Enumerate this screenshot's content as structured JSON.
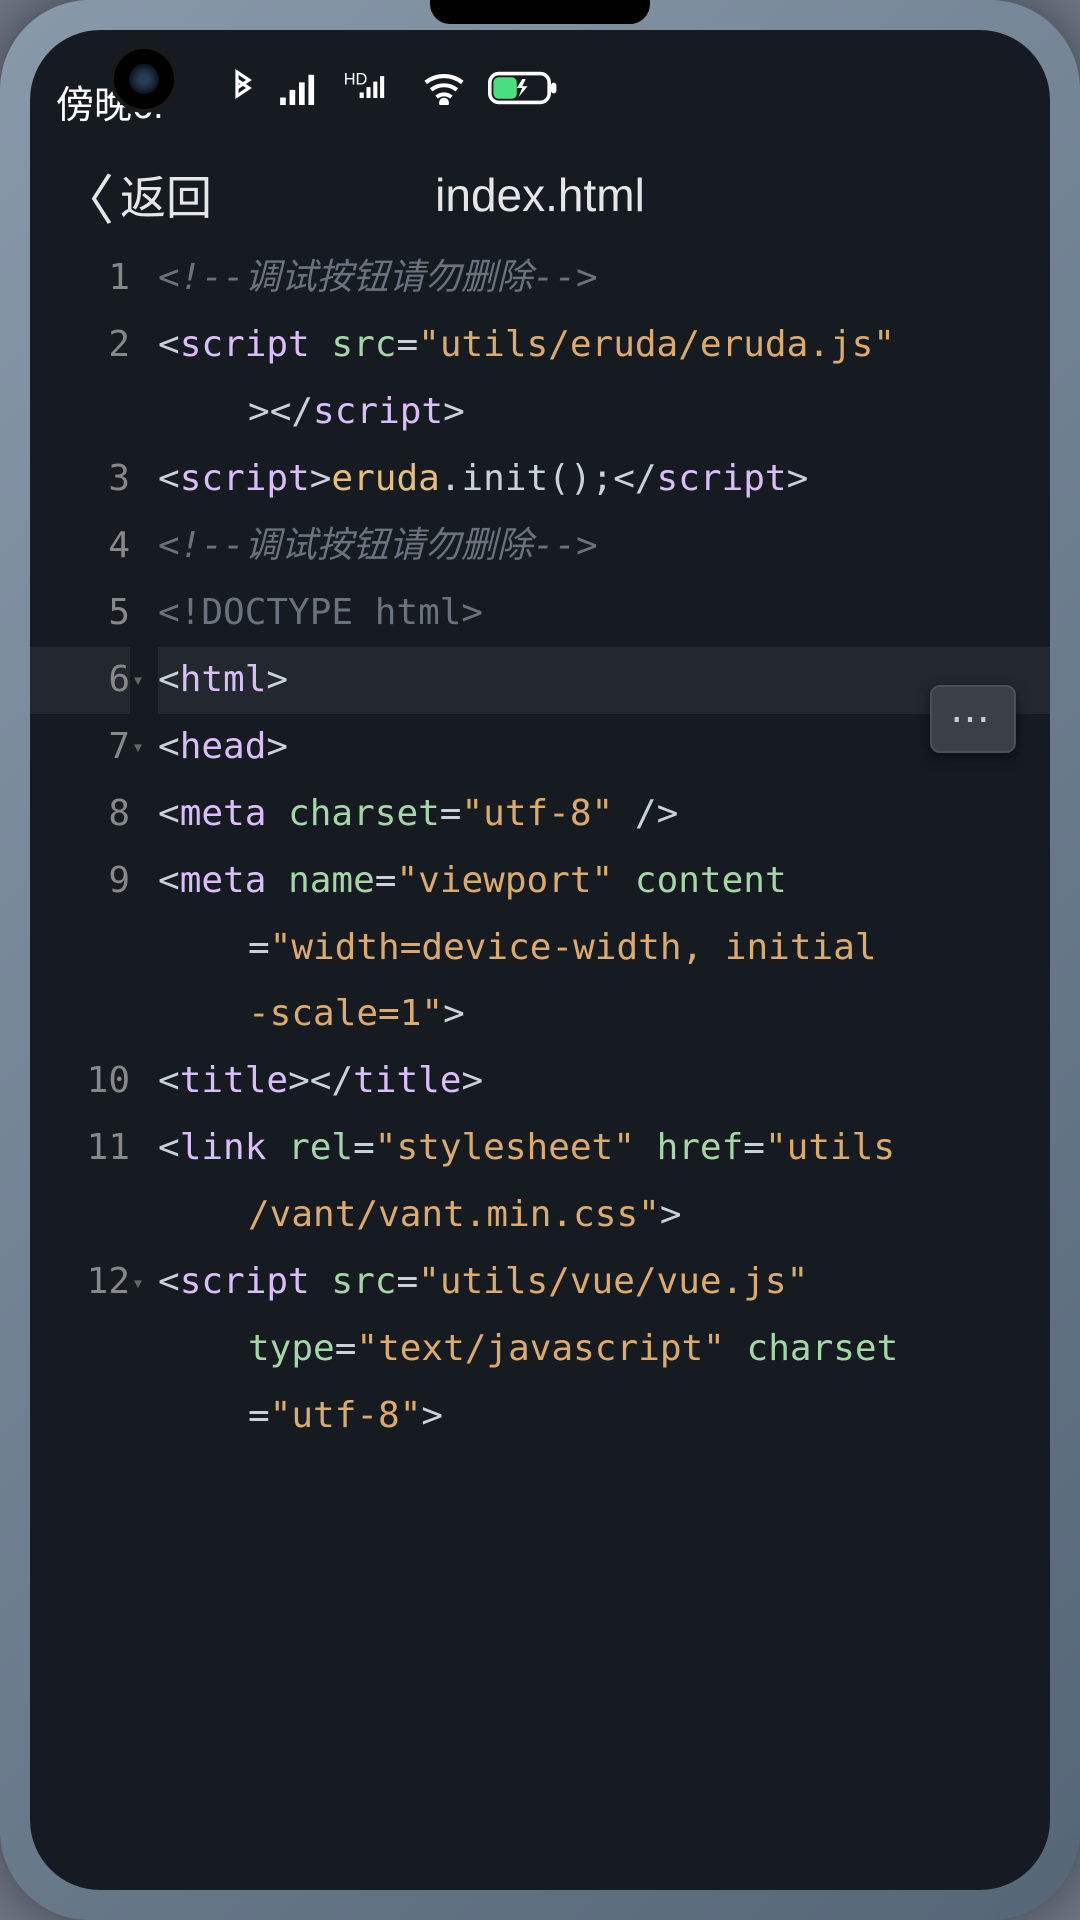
{
  "status": {
    "time_label": "傍晚6:"
  },
  "titlebar": {
    "back_label": "返回",
    "title": "index.html"
  },
  "syntax": {
    "comment": "#6a737d",
    "tag": "#dcbdfb",
    "attr": "#a5d6a7",
    "string": "#dcab6b",
    "ident": "#e6c07b"
  },
  "code": {
    "lines": [
      {
        "n": 1,
        "tokens": [
          {
            "t": "comment",
            "v": "<!--调试按钮请勿删除-->"
          }
        ]
      },
      {
        "n": 2,
        "tokens": [
          {
            "t": "bracket",
            "v": "<"
          },
          {
            "t": "tag",
            "v": "script"
          },
          {
            "t": "plain",
            "v": " "
          },
          {
            "t": "attr",
            "v": "src"
          },
          {
            "t": "op",
            "v": "="
          },
          {
            "t": "string",
            "v": "\"utils/eruda/eruda.js\""
          }
        ],
        "wrap": [
          {
            "t": "bracket",
            "v": ">"
          },
          {
            "t": "bracket",
            "v": "</"
          },
          {
            "t": "tag",
            "v": "script"
          },
          {
            "t": "bracket",
            "v": ">"
          }
        ]
      },
      {
        "n": 3,
        "tokens": [
          {
            "t": "bracket",
            "v": "<"
          },
          {
            "t": "tag",
            "v": "script"
          },
          {
            "t": "bracket",
            "v": ">"
          },
          {
            "t": "ident",
            "v": "eruda"
          },
          {
            "t": "plain",
            "v": ".init();"
          },
          {
            "t": "bracket",
            "v": "</"
          },
          {
            "t": "tag",
            "v": "script"
          },
          {
            "t": "bracket",
            "v": ">"
          }
        ]
      },
      {
        "n": 4,
        "tokens": [
          {
            "t": "comment",
            "v": "<!--调试按钮请勿删除-->"
          }
        ]
      },
      {
        "n": 5,
        "tokens": [
          {
            "t": "doctype",
            "v": "<!DOCTYPE html>"
          }
        ]
      },
      {
        "n": 6,
        "fold": true,
        "active": true,
        "tokens": [
          {
            "t": "bracket",
            "v": "<"
          },
          {
            "t": "tag",
            "v": "html"
          },
          {
            "t": "bracket",
            "v": ">"
          }
        ]
      },
      {
        "n": 7,
        "fold": true,
        "tokens": [
          {
            "t": "bracket",
            "v": "<"
          },
          {
            "t": "tag",
            "v": "head"
          },
          {
            "t": "bracket",
            "v": ">"
          }
        ]
      },
      {
        "n": 8,
        "tokens": [
          {
            "t": "bracket",
            "v": "<"
          },
          {
            "t": "tag",
            "v": "meta"
          },
          {
            "t": "plain",
            "v": " "
          },
          {
            "t": "attr",
            "v": "charset"
          },
          {
            "t": "op",
            "v": "="
          },
          {
            "t": "string",
            "v": "\"utf-8\""
          },
          {
            "t": "plain",
            "v": " "
          },
          {
            "t": "bracket",
            "v": "/>"
          }
        ]
      },
      {
        "n": 9,
        "tokens": [
          {
            "t": "bracket",
            "v": "<"
          },
          {
            "t": "tag",
            "v": "meta"
          },
          {
            "t": "plain",
            "v": " "
          },
          {
            "t": "attr",
            "v": "name"
          },
          {
            "t": "op",
            "v": "="
          },
          {
            "t": "string",
            "v": "\"viewport\""
          },
          {
            "t": "plain",
            "v": " "
          },
          {
            "t": "attr",
            "v": "content"
          }
        ],
        "wrap": [
          {
            "t": "op",
            "v": "="
          },
          {
            "t": "string",
            "v": "\"width=device-width, initial"
          }
        ],
        "wrap2": [
          {
            "t": "string",
            "v": "-scale=1\""
          },
          {
            "t": "bracket",
            "v": ">"
          }
        ]
      },
      {
        "n": 10,
        "tokens": [
          {
            "t": "bracket",
            "v": "<"
          },
          {
            "t": "tag",
            "v": "title"
          },
          {
            "t": "bracket",
            "v": ">"
          },
          {
            "t": "bracket",
            "v": "</"
          },
          {
            "t": "tag",
            "v": "title"
          },
          {
            "t": "bracket",
            "v": ">"
          }
        ]
      },
      {
        "n": 11,
        "tokens": [
          {
            "t": "bracket",
            "v": "<"
          },
          {
            "t": "tag",
            "v": "link"
          },
          {
            "t": "plain",
            "v": " "
          },
          {
            "t": "attr",
            "v": "rel"
          },
          {
            "t": "op",
            "v": "="
          },
          {
            "t": "string",
            "v": "\"stylesheet\""
          },
          {
            "t": "plain",
            "v": " "
          },
          {
            "t": "attr",
            "v": "href"
          },
          {
            "t": "op",
            "v": "="
          },
          {
            "t": "string",
            "v": "\"utils"
          }
        ],
        "wrap": [
          {
            "t": "string",
            "v": "/vant/vant.min.css\""
          },
          {
            "t": "bracket",
            "v": ">"
          }
        ]
      },
      {
        "n": 12,
        "fold": true,
        "tokens": [
          {
            "t": "bracket",
            "v": "<"
          },
          {
            "t": "tag",
            "v": "script"
          },
          {
            "t": "plain",
            "v": " "
          },
          {
            "t": "attr",
            "v": "src"
          },
          {
            "t": "op",
            "v": "="
          },
          {
            "t": "string",
            "v": "\"utils/vue/vue.js\""
          },
          {
            "t": "plain",
            "v": " "
          }
        ],
        "wrap": [
          {
            "t": "attr",
            "v": "type"
          },
          {
            "t": "op",
            "v": "="
          },
          {
            "t": "string",
            "v": "\"text/javascript\""
          },
          {
            "t": "plain",
            "v": " "
          },
          {
            "t": "attr",
            "v": "charset"
          }
        ],
        "wrap2": [
          {
            "t": "op",
            "v": "="
          },
          {
            "t": "string",
            "v": "\"utf-8\""
          },
          {
            "t": "bracket",
            "v": ">"
          }
        ]
      }
    ]
  }
}
